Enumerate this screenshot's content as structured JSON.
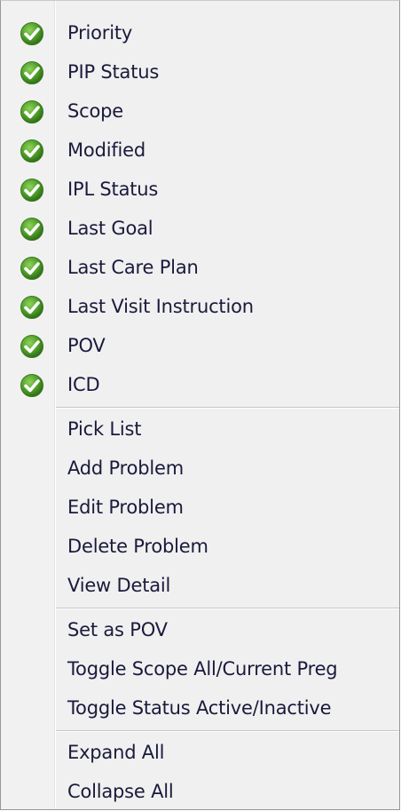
{
  "menu": {
    "checked_items": [
      {
        "label": "Priority",
        "icon": "check-circle-icon"
      },
      {
        "label": "PIP Status",
        "icon": "check-circle-icon"
      },
      {
        "label": "Scope",
        "icon": "check-circle-icon"
      },
      {
        "label": "Modified",
        "icon": "check-circle-icon"
      },
      {
        "label": "IPL Status",
        "icon": "check-circle-icon"
      },
      {
        "label": "Last Goal",
        "icon": "check-circle-icon"
      },
      {
        "label": "Last Care Plan",
        "icon": "check-circle-icon"
      },
      {
        "label": "Last Visit Instruction",
        "icon": "check-circle-icon"
      },
      {
        "label": "POV",
        "icon": "check-circle-icon"
      },
      {
        "label": "ICD",
        "icon": "check-circle-icon"
      }
    ],
    "problem_actions": [
      {
        "label": "Pick List"
      },
      {
        "label": "Add Problem"
      },
      {
        "label": "Edit Problem"
      },
      {
        "label": "Delete Problem"
      },
      {
        "label": "View Detail"
      }
    ],
    "toggle_actions": [
      {
        "label": "Set as POV"
      },
      {
        "label": "Toggle Scope All/Current Preg"
      },
      {
        "label": "Toggle Status Active/Inactive"
      }
    ],
    "tree_actions": [
      {
        "label": "Expand All"
      },
      {
        "label": "Collapse All"
      }
    ]
  },
  "colors": {
    "menu_background": "#f0f0f0",
    "text": "#1a1a3c",
    "check_green": "#4f9e2a"
  }
}
